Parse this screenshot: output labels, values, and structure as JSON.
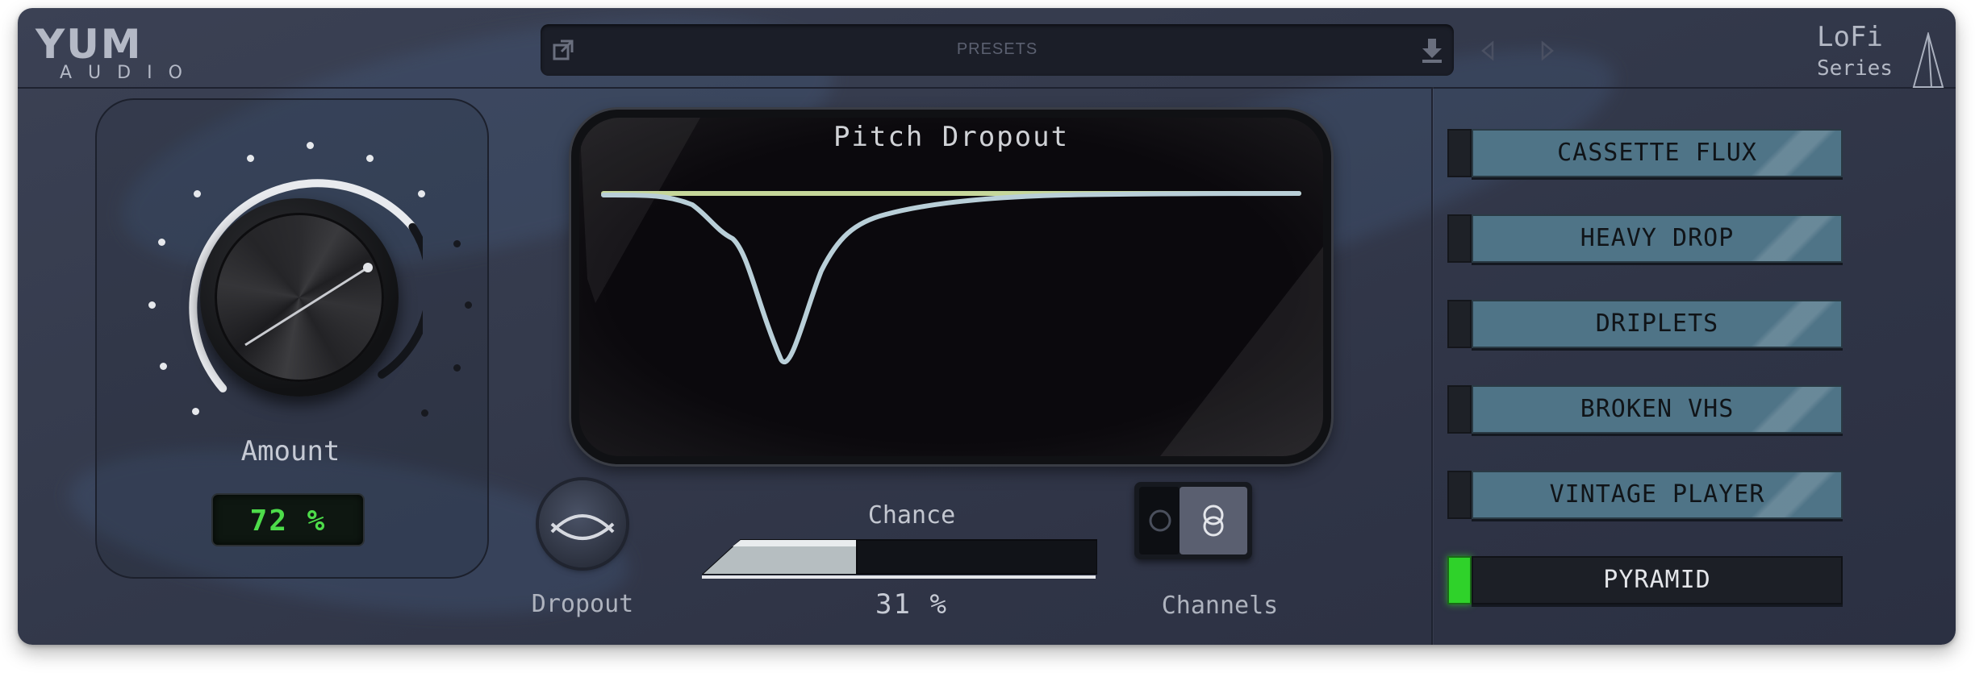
{
  "brand": {
    "logo_main": "YUM",
    "logo_sub": "AUDIO",
    "series_line1": "LoFi",
    "series_line2": "Series"
  },
  "presets_bar": {
    "label": "PRESETS"
  },
  "amount": {
    "label": "Amount",
    "value_display": "72 %",
    "value": 72
  },
  "display": {
    "title": "Pitch Dropout"
  },
  "dropout": {
    "label": "Dropout"
  },
  "chance": {
    "label": "Chance",
    "value_display": "31 %",
    "value": 31
  },
  "channels": {
    "label": "Channels"
  },
  "preset_buttons": [
    {
      "label": "CASSETTE FLUX",
      "active": false
    },
    {
      "label": "HEAVY DROP",
      "active": false
    },
    {
      "label": "DRIPLETS",
      "active": false
    },
    {
      "label": "BROKEN VHS",
      "active": false
    },
    {
      "label": "VINTAGE PLAYER",
      "active": false
    },
    {
      "label": "PYRAMID",
      "active": true
    }
  ],
  "colors": {
    "lcd_text": "#4ddc4a",
    "preset_face": "#4f7487",
    "active_led": "#2fd22a",
    "curve": "#b9cfd8",
    "baseline": "#c6d79a"
  }
}
